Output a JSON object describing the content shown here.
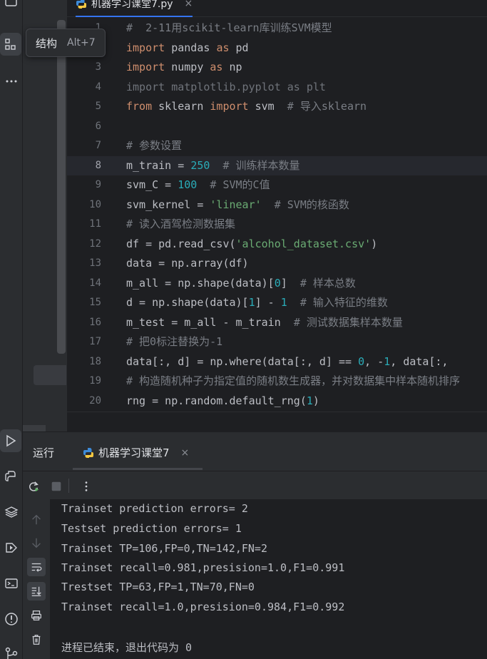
{
  "editor": {
    "tab_title": "机器学习课堂7.py",
    "current_line": 8,
    "lines": [
      {
        "n": "1",
        "tokens": [
          [
            "cm",
            "#  2-11用scikit-learn库训练SVM模型"
          ]
        ]
      },
      {
        "n": "2",
        "tokens": [
          [
            "kw",
            "import"
          ],
          [
            "",
            " pandas "
          ],
          [
            "kw",
            "as"
          ],
          [
            "",
            " pd"
          ]
        ]
      },
      {
        "n": "3",
        "tokens": [
          [
            "kw",
            "import"
          ],
          [
            "",
            " numpy "
          ],
          [
            "kw",
            "as"
          ],
          [
            "",
            " np"
          ]
        ]
      },
      {
        "n": "4",
        "tokens": [
          [
            "faded",
            "import matplotlib.pyplot as plt"
          ]
        ]
      },
      {
        "n": "5",
        "tokens": [
          [
            "kw",
            "from"
          ],
          [
            "",
            " sklearn "
          ],
          [
            "kw",
            "import"
          ],
          [
            "",
            " svm  "
          ],
          [
            "cm",
            "# 导入sklearn"
          ]
        ]
      },
      {
        "n": "6",
        "tokens": []
      },
      {
        "n": "7",
        "tokens": [
          [
            "cm",
            "# 参数设置"
          ]
        ]
      },
      {
        "n": "8",
        "tokens": [
          [
            "",
            "m_train = "
          ],
          [
            "num",
            "250"
          ],
          [
            "",
            "  "
          ],
          [
            "cm",
            "# 训练样本数量"
          ]
        ]
      },
      {
        "n": "9",
        "tokens": [
          [
            "",
            "svm_C = "
          ],
          [
            "num",
            "100"
          ],
          [
            "",
            "  "
          ],
          [
            "cm",
            "# SVM的C值"
          ]
        ]
      },
      {
        "n": "10",
        "tokens": [
          [
            "",
            "svm_kernel = "
          ],
          [
            "str",
            "'linear'"
          ],
          [
            "",
            "  "
          ],
          [
            "cm",
            "# SVM的核函数"
          ]
        ]
      },
      {
        "n": "11",
        "tokens": [
          [
            "cm",
            "# 读入酒驾检测数据集"
          ]
        ]
      },
      {
        "n": "12",
        "tokens": [
          [
            "",
            "df = pd.read_csv("
          ],
          [
            "str",
            "'alcohol_dataset.csv'"
          ],
          [
            "",
            ")"
          ]
        ]
      },
      {
        "n": "13",
        "tokens": [
          [
            "",
            "data = np.array(df)"
          ]
        ]
      },
      {
        "n": "14",
        "tokens": [
          [
            "",
            "m_all = np.shape(data)["
          ],
          [
            "num",
            "0"
          ],
          [
            "",
            "]  "
          ],
          [
            "cm",
            "# 样本总数"
          ]
        ]
      },
      {
        "n": "15",
        "tokens": [
          [
            "",
            "d = np.shape(data)["
          ],
          [
            "num",
            "1"
          ],
          [
            "",
            "] - "
          ],
          [
            "num",
            "1"
          ],
          [
            "",
            "  "
          ],
          [
            "cm",
            "# 输入特征的维数"
          ]
        ]
      },
      {
        "n": "16",
        "tokens": [
          [
            "",
            "m_test = m_all - m_train  "
          ],
          [
            "cm",
            "# 测试数据集样本数量"
          ]
        ]
      },
      {
        "n": "17",
        "tokens": [
          [
            "cm",
            "# 把0标注替换为-1"
          ]
        ]
      },
      {
        "n": "18",
        "tokens": [
          [
            "",
            "data[:, d] = np.where(data[:, d] == "
          ],
          [
            "num",
            "0"
          ],
          [
            "",
            ", -"
          ],
          [
            "num",
            "1"
          ],
          [
            "",
            ", data[:, "
          ]
        ]
      },
      {
        "n": "19",
        "tokens": [
          [
            "cm",
            "# 构造随机种子为指定值的随机数生成器，并对数据集中样本随机排序"
          ]
        ]
      },
      {
        "n": "20",
        "tokens": [
          [
            "",
            "rng = np.random.default_rng("
          ],
          [
            "num",
            "1"
          ],
          [
            "",
            ")"
          ]
        ]
      }
    ]
  },
  "tooltip": {
    "label": "结构",
    "shortcut": "Alt+7"
  },
  "run": {
    "title": "运行",
    "tab_label": "机器学习课堂7",
    "output": [
      "Trainset prediction errors= 2",
      "Testset prediction errors= 1",
      "Trainset TP=106,FP=0,TN=142,FN=2",
      "Trainset recall=0.981,presision=1.0,F1=0.991",
      "Trestset TP=63,FP=1,TN=70,FN=0",
      "Trainset recall=1.0,presision=0.984,F1=0.992",
      "",
      "进程已结束，退出代码为 0"
    ]
  },
  "colors": {
    "background": "#1e1f22",
    "panel": "#2b2d30",
    "keyword": "#cf8e6d",
    "comment": "#7a7e85",
    "number": "#2aacb8",
    "string": "#6aab73",
    "accent": "#3574f0"
  },
  "icons": {
    "left_strip": [
      "folder-icon",
      "structure-icon",
      "more-icon",
      "run-icon",
      "python-console-icon",
      "layers-icon",
      "services-icon",
      "terminal-icon",
      "problems-icon",
      "git-icon"
    ],
    "run_toolbar": [
      "rerun-icon",
      "stop-icon",
      "more-vertical-icon"
    ],
    "run_side": [
      "arrow-up-icon",
      "arrow-down-icon",
      "soft-wrap-icon",
      "scroll-to-end-icon",
      "print-icon",
      "trash-icon"
    ]
  }
}
